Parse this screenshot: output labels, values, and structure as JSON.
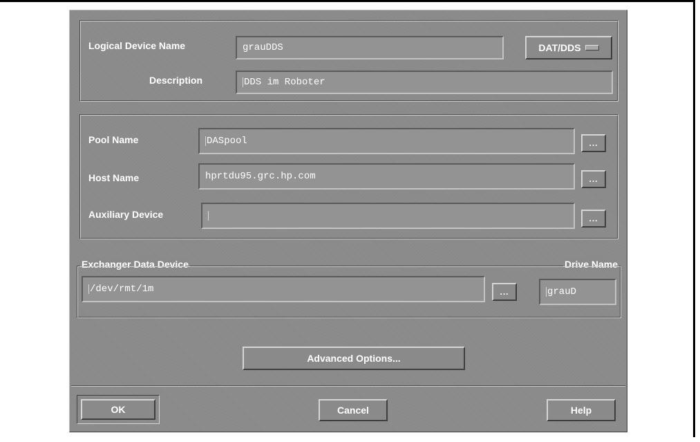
{
  "device": {
    "logical_name_label": "Logical Device Name",
    "logical_name_value": "grauDDS",
    "type_option": "DAT/DDS",
    "description_label": "Description",
    "description_value": "DDS im Roboter"
  },
  "pool": {
    "pool_label": "Pool Name",
    "pool_value": "DASpool",
    "host_label": "Host Name",
    "host_value": "hprtdu95.grc.hp.com",
    "aux_label": "Auxiliary Device",
    "aux_value": "",
    "browse_label": "..."
  },
  "exchanger": {
    "legend": "Exchanger Data Device",
    "value": "/dev/rmt/1m",
    "drive_legend": "Drive Name",
    "drive_value": "grauD"
  },
  "advanced_label": "Advanced Options...",
  "buttons": {
    "ok": "OK",
    "cancel": "Cancel",
    "help": "Help"
  },
  "colors": {
    "dialog_bg": "#8a8a8a",
    "text": "#ffffff"
  }
}
